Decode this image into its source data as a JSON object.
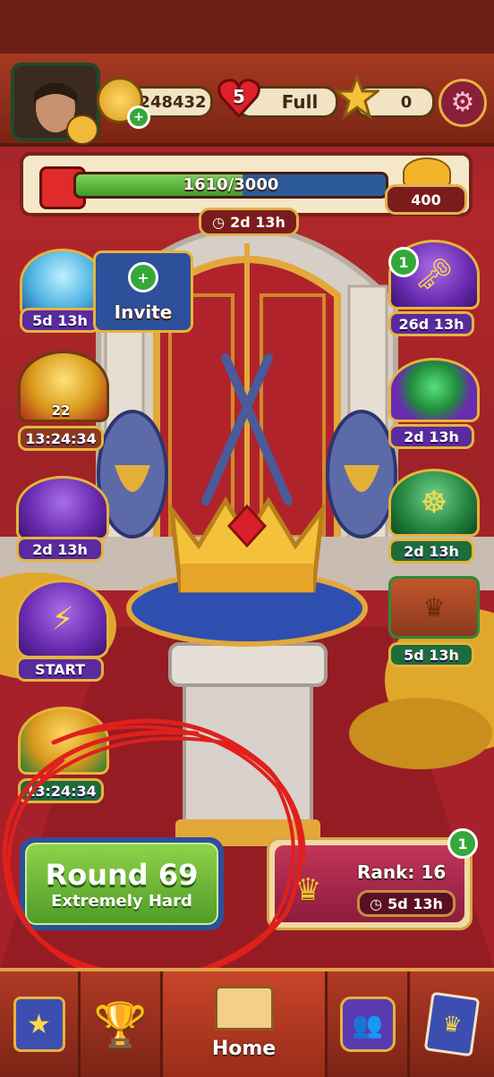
{
  "header": {
    "coins": "248432",
    "lives_count": "5",
    "lives_status": "Full",
    "stars": "0",
    "plus_glyph": "+",
    "heart_icon": "heart-icon",
    "star_icon": "star-icon",
    "settings_icon": "gear-icon"
  },
  "progress": {
    "text": "1610/3000",
    "current": 1610,
    "max": 3000,
    "reward": "400",
    "timer": "2d 13h"
  },
  "left_events": [
    {
      "name": "crystal-event",
      "timer": "5d 13h"
    },
    {
      "name": "trophy-event",
      "count": "22",
      "timer": "13:24:34"
    },
    {
      "name": "treasure-pot-event",
      "timer": "2d 13h"
    },
    {
      "name": "lightning-event",
      "action": "START"
    },
    {
      "name": "crown-event",
      "timer": "13:24:34"
    }
  ],
  "invite": {
    "label": "Invite",
    "plus": "+"
  },
  "right_events": [
    {
      "name": "key-event",
      "badge": "1",
      "timer": "26d 13h"
    },
    {
      "name": "green-chest-event",
      "timer": "2d 13h"
    },
    {
      "name": "ship-wheel-event",
      "timer": "2d 13h"
    },
    {
      "name": "crown-chest-event",
      "timer": "5d 13h"
    }
  ],
  "play": {
    "title": "Round 69",
    "subtitle": "Extremely Hard"
  },
  "rank": {
    "label": "Rank: 16",
    "timer": "5d 13h",
    "badge": "1"
  },
  "nav": {
    "home_label": "Home"
  },
  "colors": {
    "accent_gold": "#e6b43a",
    "play_green": "#4f9c28",
    "annotation_red": "#e0201c"
  }
}
